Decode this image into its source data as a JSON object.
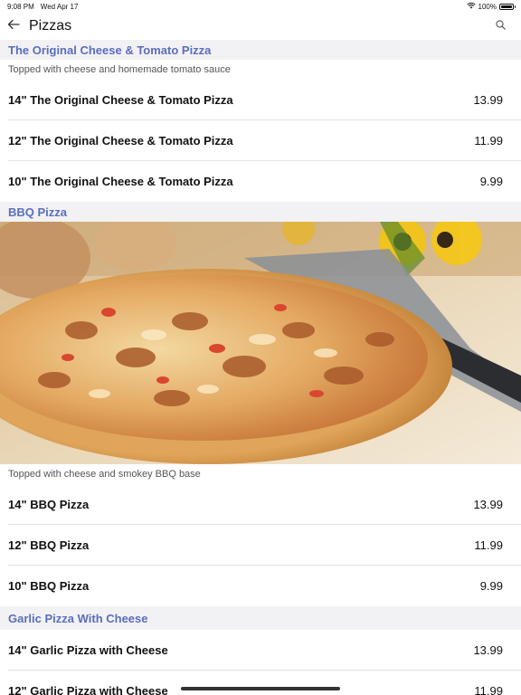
{
  "status_bar": {
    "time": "9:08 PM",
    "date": "Wed Apr 17",
    "battery": "100%",
    "battery_level": 1.0
  },
  "nav": {
    "title": "Pizzas",
    "back_icon": "arrow-left-icon",
    "search_icon": "search-icon"
  },
  "sections": [
    {
      "title": "The Original Cheese & Tomato Pizza",
      "description": "Topped with cheese and homemade tomato sauce",
      "items": [
        {
          "name": "14\" The Original Cheese & Tomato Pizza",
          "price": "13.99"
        },
        {
          "name": "12\" The Original Cheese & Tomato Pizza",
          "price": "11.99"
        },
        {
          "name": "10\" The Original Cheese & Tomato Pizza",
          "price": "9.99"
        }
      ]
    },
    {
      "title": "BBQ Pizza",
      "description": "Topped with cheese and smokey BBQ base",
      "items": [
        {
          "name": "14\" BBQ Pizza",
          "price": "13.99"
        },
        {
          "name": "12\" BBQ Pizza",
          "price": "11.99"
        },
        {
          "name": "10\" BBQ Pizza",
          "price": "9.99"
        }
      ]
    },
    {
      "title": "Garlic Pizza With Cheese",
      "items": [
        {
          "name": "14\" Garlic Pizza with Cheese",
          "price": "13.99"
        },
        {
          "name": "12\" Garlic Pizza with Cheese",
          "price": "11.99"
        }
      ]
    }
  ],
  "colors": {
    "section_title": "#5b6dbf",
    "section_background": "#f2f2f4",
    "divider": "#e2e2e2"
  }
}
